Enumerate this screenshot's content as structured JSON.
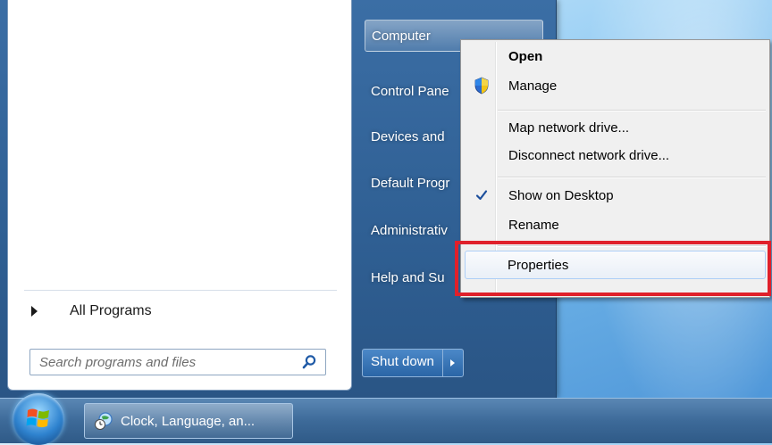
{
  "start_menu": {
    "all_programs_label": "All Programs",
    "search_placeholder": "Search programs and files",
    "right_pane_items": [
      "Computer",
      "Control Pane",
      "Devices and",
      "Default Progr",
      "Administrativ",
      "Help and Su"
    ],
    "shutdown_label": "Shut down"
  },
  "context_menu": {
    "items": [
      {
        "label": "Open",
        "bold": true,
        "icon": null,
        "checked": false
      },
      {
        "label": "Manage",
        "bold": false,
        "icon": "uac-shield-icon",
        "checked": false
      },
      {
        "label": "Map network drive...",
        "bold": false,
        "icon": null,
        "checked": false
      },
      {
        "label": "Disconnect network drive...",
        "bold": false,
        "icon": null,
        "checked": false
      },
      {
        "label": "Show on Desktop",
        "bold": false,
        "icon": "checkmark-icon",
        "checked": true
      },
      {
        "label": "Rename",
        "bold": false,
        "icon": null,
        "checked": false
      },
      {
        "label": "Properties",
        "bold": false,
        "icon": null,
        "checked": false,
        "selected": true
      }
    ],
    "highlight_color": "#e0202a"
  },
  "taskbar": {
    "task_label": "Clock, Language, an..."
  },
  "colors": {
    "start_menu_blue": "#2f5f93",
    "highlight_red": "#e0202a"
  }
}
